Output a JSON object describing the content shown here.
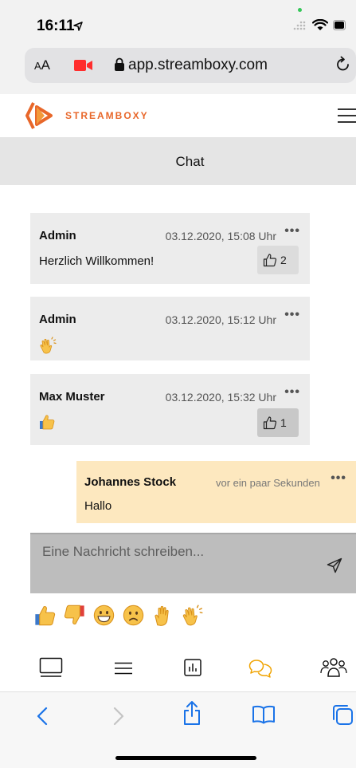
{
  "status_bar": {
    "time": "16:11",
    "location_icon": "location-arrow-icon",
    "icons": [
      "signal-icon",
      "wifi-icon",
      "battery-icon"
    ]
  },
  "url_bar": {
    "text_size_label": "AA",
    "url": "app.streamboxy.com",
    "icons": [
      "camera-recording-icon",
      "lock-icon",
      "reload-icon"
    ]
  },
  "header": {
    "brand": "STREAMBOXY",
    "brand_color": "#e8672a",
    "menu_icon": "hamburger-icon"
  },
  "chat": {
    "title": "Chat",
    "messages": [
      {
        "author": "Admin",
        "time": "03.12.2020, 15:08 Uhr",
        "text": "Herzlich Willkommen!",
        "likes": "2"
      },
      {
        "author": "Admin",
        "time": "03.12.2020, 15:12 Uhr",
        "emoji": "clapping-hands"
      },
      {
        "author": "Max Muster",
        "time": "03.12.2020, 15:32 Uhr",
        "emoji": "thumbs-up",
        "likes": "1"
      }
    ],
    "own_message": {
      "author": "Johannes Stock",
      "time": "vor ein paar Sekunden",
      "text": "Hallo",
      "background": "#fde8bf"
    },
    "more_label": "•••"
  },
  "composer": {
    "placeholder": "Eine Nachricht schreiben...",
    "send_icon": "send-icon"
  },
  "emoji_bar": [
    "thumbs-up",
    "thumbs-down",
    "grinning-face",
    "frowning-face",
    "raised-hand",
    "clapping-hands"
  ],
  "app_tabs": [
    {
      "icon": "screen-icon",
      "active": false
    },
    {
      "icon": "agenda-icon",
      "active": false
    },
    {
      "icon": "poll-icon",
      "active": false
    },
    {
      "icon": "chat-icon",
      "active": true
    },
    {
      "icon": "participants-icon",
      "active": false
    }
  ],
  "active_color": "#f0a300",
  "safari_toolbar": [
    "back-icon",
    "forward-icon",
    "share-icon",
    "bookmarks-icon",
    "tabs-icon"
  ]
}
